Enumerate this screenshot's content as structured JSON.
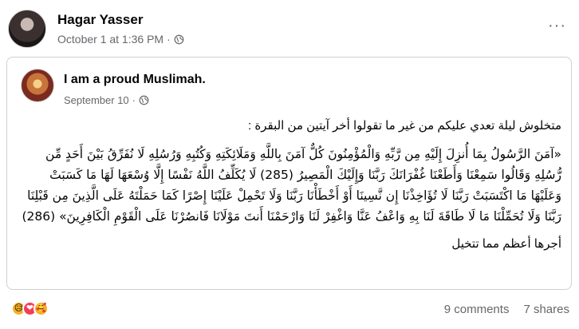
{
  "post": {
    "author": "Hagar Yasser",
    "timestamp": "October 1 at 1:36 PM",
    "separator": "·",
    "privacy_icon": "globe-icon",
    "more_icon": "ellipsis-icon",
    "more_label": "···"
  },
  "shared": {
    "page_name": "I am a proud Muslimah.",
    "timestamp": "September 10",
    "separator": "·",
    "privacy_icon": "globe-icon",
    "intro": "متخلوش ليلة تعدي عليكم من غير ما تقولوا أخر آيتين من البقرة :",
    "verse": "«آمَنَ الرَّسُولُ بِمَا أُنزِلَ إِلَيْهِ مِن رَّبِّهِ وَالْمُؤْمِنُونَ كُلٌّ آمَنَ بِاللَّهِ وَمَلَائِكَتِهِ وَكُتُبِهِ وَرُسُلِهِ لَا نُفَرِّقُ بَيْنَ أَحَدٍ مِّن رُّسُلِهِ وَقَالُوا سَمِعْنَا وَأَطَعْنَا غُفْرَانَكَ رَبَّنَا وَإِلَيْكَ الْمَصِيرُ (285) لَا يُكَلِّفُ اللَّهُ نَفْسًا إِلَّا وُسْعَهَا لَهَا مَا كَسَبَتْ وَعَلَيْهَا مَا اكْتَسَبَتْ رَبَّنَا لَا تُؤَاخِذْنَا إِن نَّسِينَا أَوْ أَخْطَأْنَا رَبَّنَا وَلَا تَحْمِلْ عَلَيْنَا إِصْرًا كَمَا حَمَلْتَهُ عَلَى الَّذِينَ مِن قَبْلِنَا رَبَّنَا وَلَا تُحَمِّلْنَا مَا لَا طَاقَةَ لَنَا بِهِ وَاعْفُ عَنَّا وَاغْفِرْ لَنَا وَارْحَمْنَا أَنتَ مَوْلَانَا فَانصُرْنَا عَلَى الْقَوْمِ الْكَافِرِينَ» (286)",
    "closing": "أجرها أعظم مما تتخيل"
  },
  "footer": {
    "reactions": [
      {
        "icon": "sad-reaction-icon",
        "glyph": "😥",
        "color": "#f7b125"
      },
      {
        "icon": "love-reaction-icon",
        "glyph": "❤",
        "color": "#f33e58"
      },
      {
        "icon": "care-reaction-icon",
        "glyph": "🥰",
        "color": "#f7b125"
      }
    ],
    "comments": "9 comments",
    "shares": "7 shares"
  }
}
